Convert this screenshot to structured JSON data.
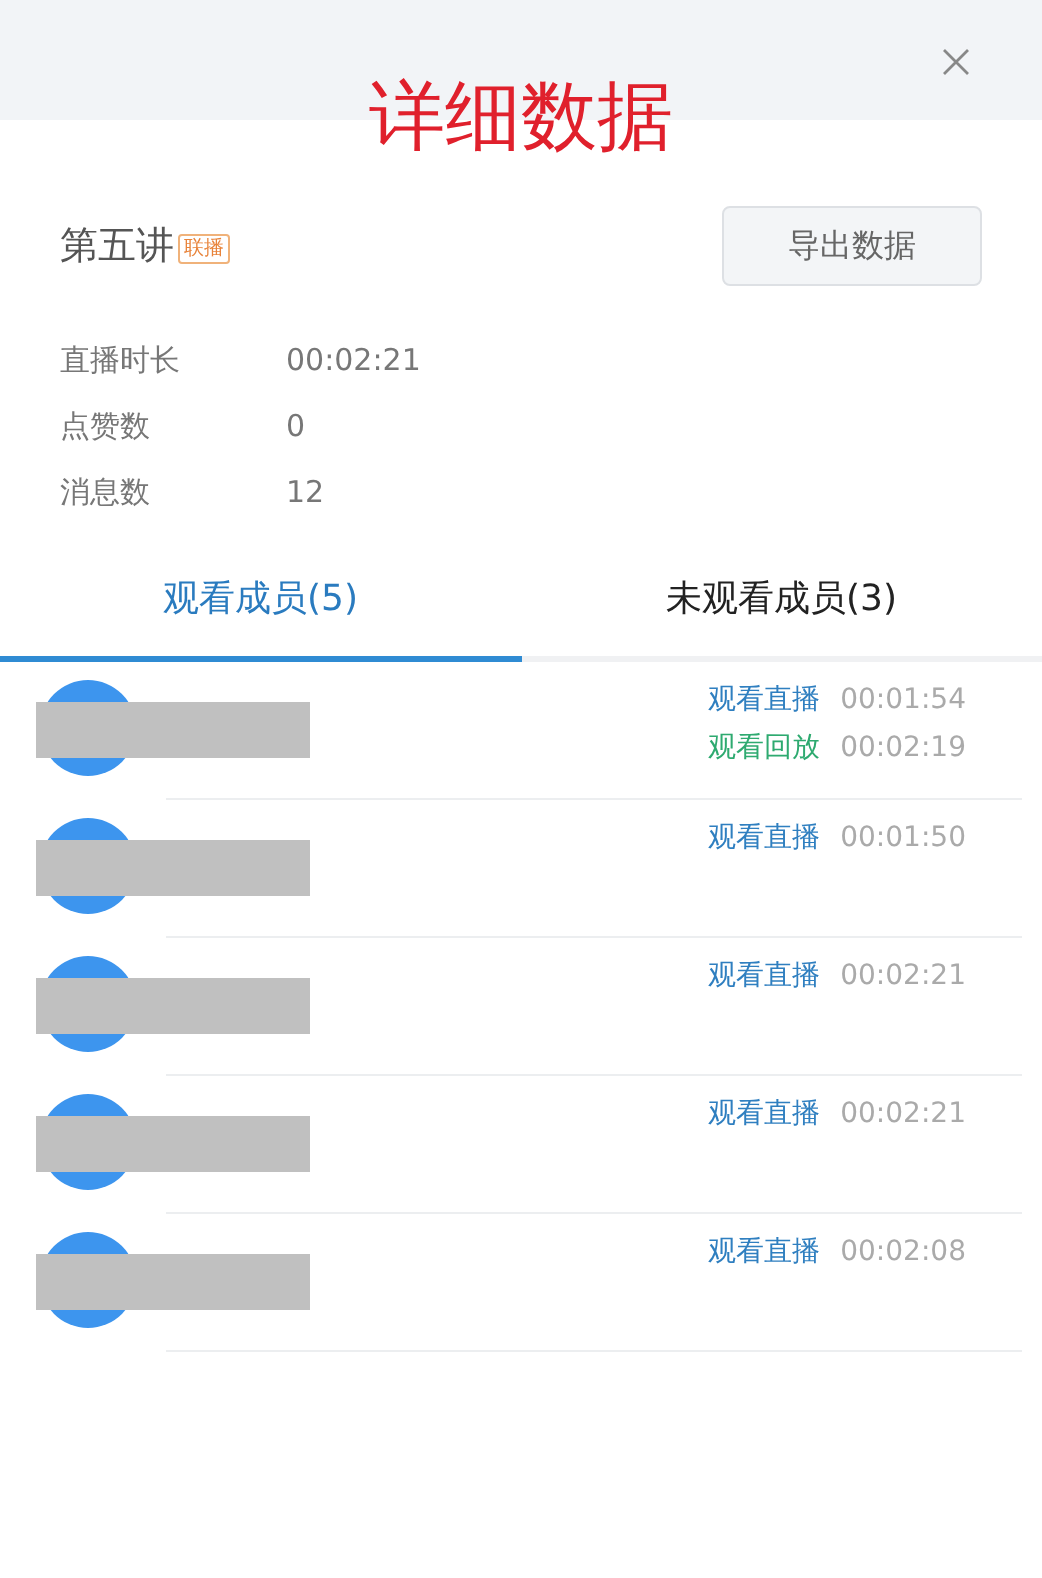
{
  "title": "详细数据",
  "lecture": {
    "name": "第五讲",
    "tag": "联播"
  },
  "export_button": "导出数据",
  "stats": [
    {
      "label": "直播时长",
      "value": "00:02:21"
    },
    {
      "label": "点赞数",
      "value": "0"
    },
    {
      "label": "消息数",
      "value": "12"
    }
  ],
  "tabs": [
    {
      "label": "观看成员(5)",
      "selected": true
    },
    {
      "label": "未观看成员(3)",
      "selected": false
    }
  ],
  "members": [
    {
      "records": [
        {
          "kind": "live",
          "label": "观看直播",
          "time": "00:01:54"
        },
        {
          "kind": "replay",
          "label": "观看回放",
          "time": "00:02:19"
        }
      ]
    },
    {
      "records": [
        {
          "kind": "live",
          "label": "观看直播",
          "time": "00:01:50"
        }
      ]
    },
    {
      "records": [
        {
          "kind": "live",
          "label": "观看直播",
          "time": "00:02:21"
        }
      ]
    },
    {
      "records": [
        {
          "kind": "live",
          "label": "观看直播",
          "time": "00:02:21"
        }
      ]
    },
    {
      "records": [
        {
          "kind": "live",
          "label": "观看直播",
          "time": "00:02:08"
        }
      ]
    }
  ]
}
